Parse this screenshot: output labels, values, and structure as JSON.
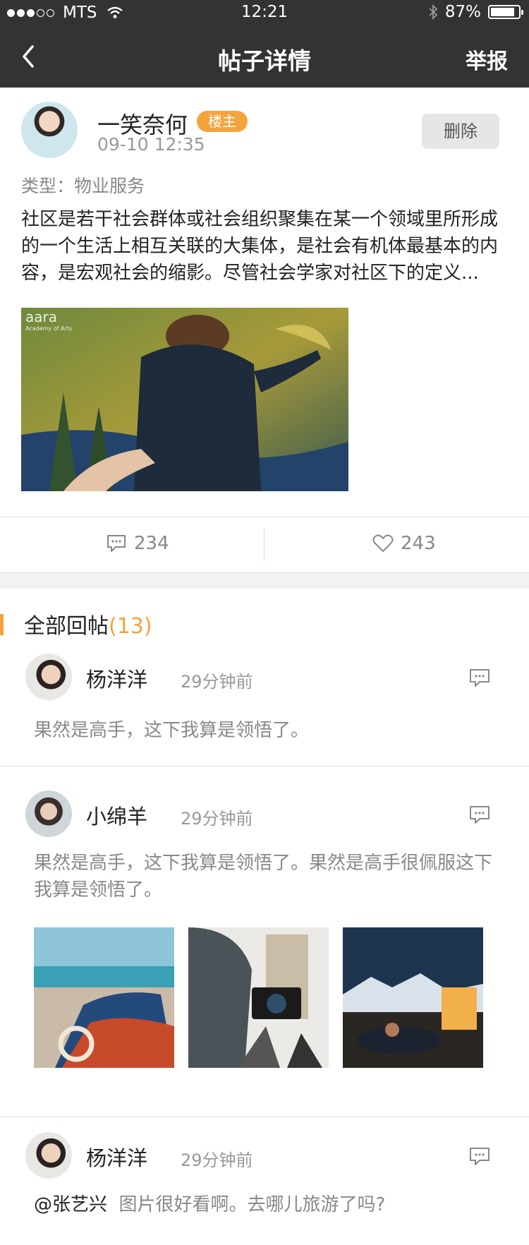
{
  "status_bar": {
    "carrier": "MTS",
    "time": "12:21",
    "battery_percent": "87%",
    "battery_level": 0.87,
    "signal_bars_filled": 3,
    "signal_bars_total": 5
  },
  "nav": {
    "title": "帖子详情",
    "report_label": "举报"
  },
  "post": {
    "author": "一笑奈何",
    "badge": "楼主",
    "time": "09-10   12:35",
    "delete_label": "删除",
    "type": "类型：物业服务",
    "content": "社区是若干社会群体或社会组织聚集在某一个领域里所形成的一个生活上相互关联的大集体，是社会有机体最基本的内容，是宏观社会的缩影。尽管社会学家对社区下的定义...",
    "photo_logo": "aara",
    "photo_caption": "Academy of Arts",
    "comment_count": "234",
    "like_count": "243"
  },
  "replies": {
    "label": "全部回帖",
    "count": "(13)",
    "items": [
      {
        "name": "杨洋洋",
        "time": "29分钟前",
        "text": "果然是高手，这下我算是领悟了。"
      },
      {
        "name": "小绵羊",
        "time": "29分钟前",
        "text": "果然是高手，这下我算是领悟了。果然是高手很佩服这下我算是领悟了。"
      },
      {
        "name": "杨洋洋",
        "time": "29分钟前",
        "mention": "@张艺兴",
        "text": "图片很好看啊。去哪儿旅游了吗?"
      }
    ]
  },
  "colors": {
    "accent": "#f5a33b",
    "topbar": "#333333"
  }
}
